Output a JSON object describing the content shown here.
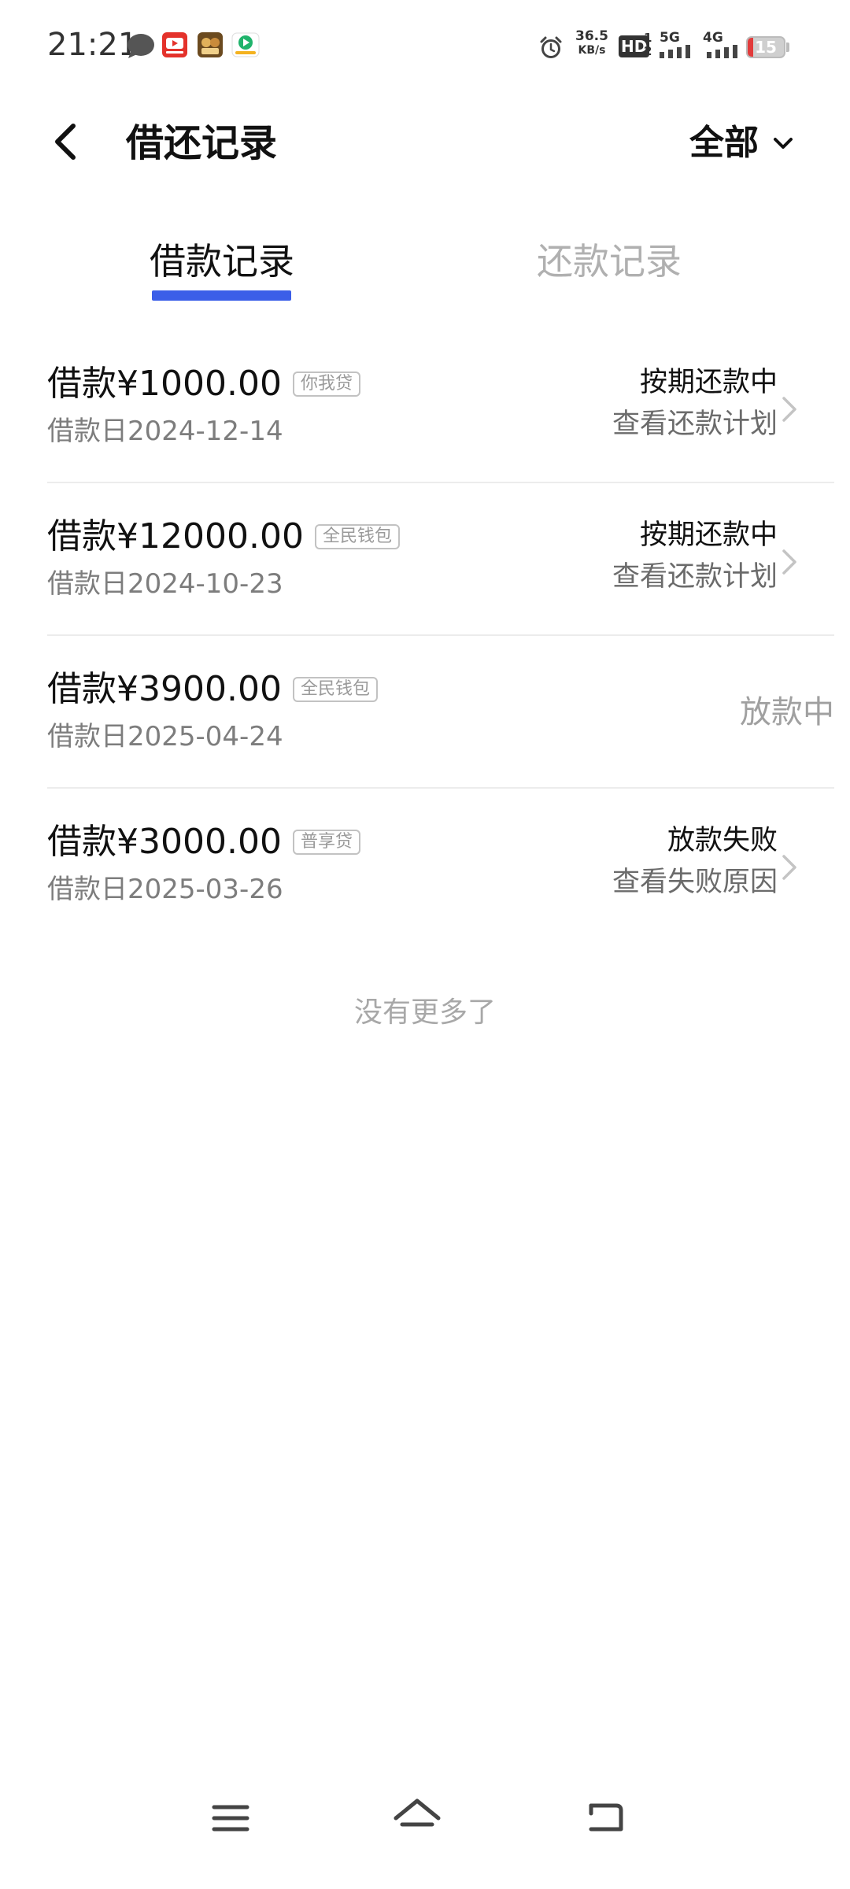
{
  "status_bar": {
    "time": "21:21",
    "net_speed_value": "36.5",
    "net_speed_unit": "KB/s",
    "hd_label": "HD",
    "hd_sub": "1 2",
    "sig1_label": "5G",
    "sig2_label": "4G",
    "battery_level": "15",
    "battery_fraction": 0.15
  },
  "header": {
    "title": "借还记录",
    "filter_label": "全部"
  },
  "tabs": {
    "active": "借款记录",
    "inactive": "还款记录"
  },
  "records": [
    {
      "amount": "借款¥1000.00",
      "tag": "你我贷",
      "date": "借款日2024-12-14",
      "status": "按期还款中",
      "link": "查看还款计划"
    },
    {
      "amount": "借款¥12000.00",
      "tag": "全民钱包",
      "date": "借款日2024-10-23",
      "status": "按期还款中",
      "link": "查看还款计划"
    },
    {
      "amount": "借款¥3900.00",
      "tag": "全民钱包",
      "date": "借款日2025-04-24",
      "status": "放款中"
    },
    {
      "amount": "借款¥3000.00",
      "tag": "普享贷",
      "date": "借款日2025-03-26",
      "status": "放款失败",
      "link": "查看失败原因"
    }
  ],
  "footer": {
    "no_more": "没有更多了"
  },
  "colors": {
    "accent": "#3b5ee8",
    "battery_low": "#e23b3b"
  },
  "icons": {
    "back": "chevron-left-icon",
    "filter": "chevron-down-icon",
    "row": "chevron-right-icon",
    "nav_menu": "menu-icon",
    "nav_home": "home-icon",
    "nav_back": "back-icon"
  }
}
